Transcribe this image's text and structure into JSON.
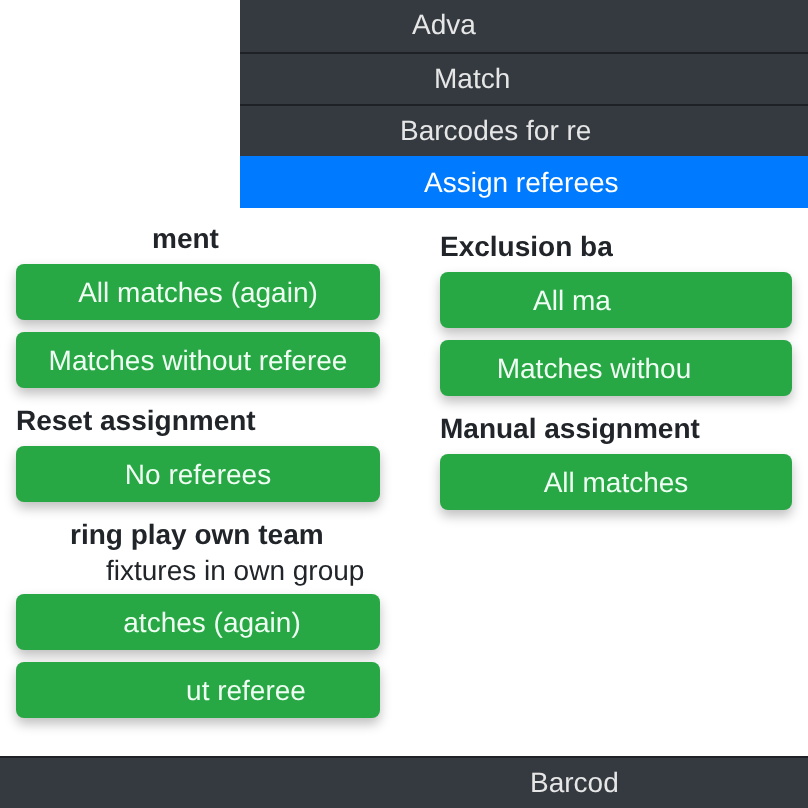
{
  "top_nav": {
    "items": [
      {
        "label": "Adva",
        "selected": false
      },
      {
        "label": "Match",
        "selected": false
      },
      {
        "label": "Barcodes for re",
        "selected": false
      },
      {
        "label": "Assign referees",
        "selected": true
      }
    ]
  },
  "left_column": [
    {
      "kind": "heading",
      "text": "ment"
    },
    {
      "kind": "button",
      "label": "All matches (again)"
    },
    {
      "kind": "button",
      "label": "Matches without referee"
    },
    {
      "kind": "heading",
      "text": "Reset assignment"
    },
    {
      "kind": "button",
      "label": "No referees"
    },
    {
      "kind": "heading",
      "text": "ring play own team"
    },
    {
      "kind": "text",
      "text": "fixtures in own group"
    },
    {
      "kind": "button",
      "label": "atches (again)"
    },
    {
      "kind": "button",
      "label": "ut referee"
    }
  ],
  "right_column": [
    {
      "kind": "heading",
      "text": "Exclusion ba"
    },
    {
      "kind": "button",
      "label": "All ma"
    },
    {
      "kind": "button",
      "label": "Matches withou"
    },
    {
      "kind": "heading",
      "text": "Manual assignment"
    },
    {
      "kind": "button",
      "label": "All matches"
    }
  ],
  "bottom_nav": {
    "items": [
      {
        "label": "Barcod"
      }
    ]
  }
}
